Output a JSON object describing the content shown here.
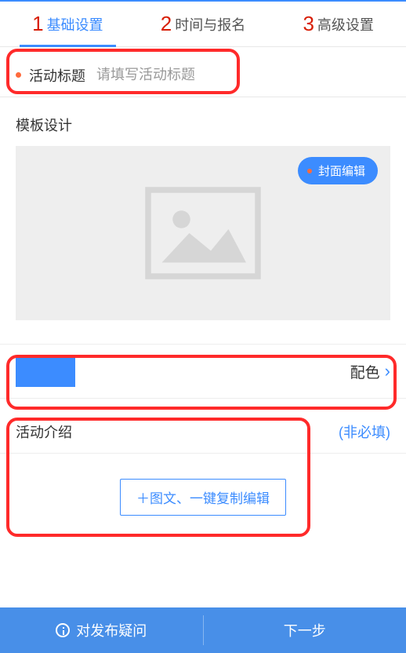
{
  "tabs": [
    {
      "num": "1",
      "label": "基础设置",
      "active": true
    },
    {
      "num": "2",
      "label": "时间与报名",
      "active": false
    },
    {
      "num": "3",
      "label": "高级设置",
      "active": false
    }
  ],
  "title": {
    "label": "活动标题",
    "placeholder": "请填写活动标题",
    "value": ""
  },
  "template": {
    "heading": "模板设计",
    "cover_edit_label": "封面编辑"
  },
  "color": {
    "swatch": "#3c8cff",
    "label": "配色"
  },
  "intro": {
    "label": "活动介绍",
    "optional": "(非必填)",
    "button": "＋图文、一键复制编辑"
  },
  "footer": {
    "left": "对发布疑问",
    "right": "下一步"
  }
}
